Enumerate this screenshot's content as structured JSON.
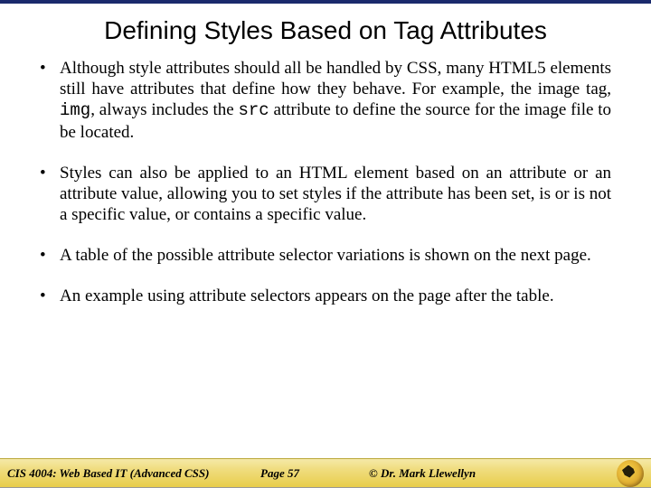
{
  "title": "Defining Styles Based on Tag Attributes",
  "bullets": {
    "b1_pre": "Although style attributes should all be handled by CSS, many HTML5 elements still have attributes that define how they behave. For example, the image tag, ",
    "b1_code1": "img",
    "b1_mid": ", always includes the ",
    "b1_code2": "src",
    "b1_post": " attribute to define the source for the image file to be located.",
    "b2": "Styles can also be applied to an HTML element based on an attribute or an attribute value, allowing you to set styles if the attribute has been set, is or is not a specific value, or contains a specific value.",
    "b3": "A table of the possible attribute selector variations is shown on the next page.",
    "b4": "An example using attribute selectors appears on the page after the table."
  },
  "footer": {
    "course": "CIS 4004: Web Based IT (Advanced CSS)",
    "page": "Page 57",
    "author": "© Dr. Mark Llewellyn"
  }
}
